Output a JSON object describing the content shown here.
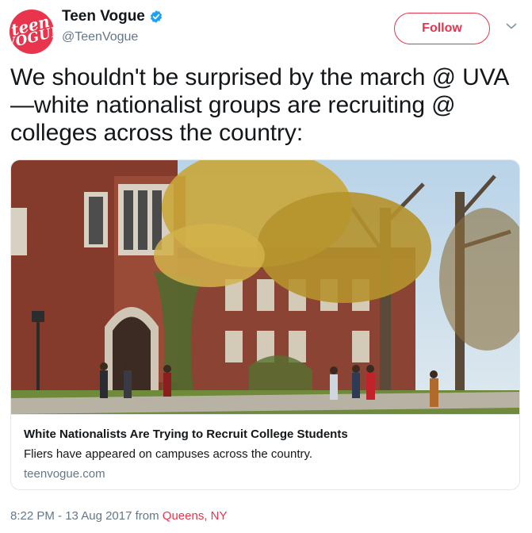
{
  "account": {
    "display_name": "Teen Vogue",
    "handle": "@TeenVogue",
    "avatar_line1": "teen",
    "avatar_line2": "VOGUE",
    "verified_icon": "verified-badge-icon",
    "brand_color": "#e8344c"
  },
  "actions": {
    "follow_label": "Follow",
    "more_icon": "chevron-down-icon"
  },
  "tweet": {
    "text": "We shouldn't be surprised by the march @ UVA—white nationalist groups are recruiting @ colleges across the country:"
  },
  "card": {
    "title": "White Nationalists Are Trying to Recruit College Students",
    "description": "Fliers have appeared on campuses across the country.",
    "domain": "teenvogue.com"
  },
  "meta": {
    "time": "8:22 PM - 13 Aug 2017",
    "from_label": "from",
    "location": "Queens, NY",
    "link_color": "#e8344c",
    "muted_color": "#657786"
  }
}
